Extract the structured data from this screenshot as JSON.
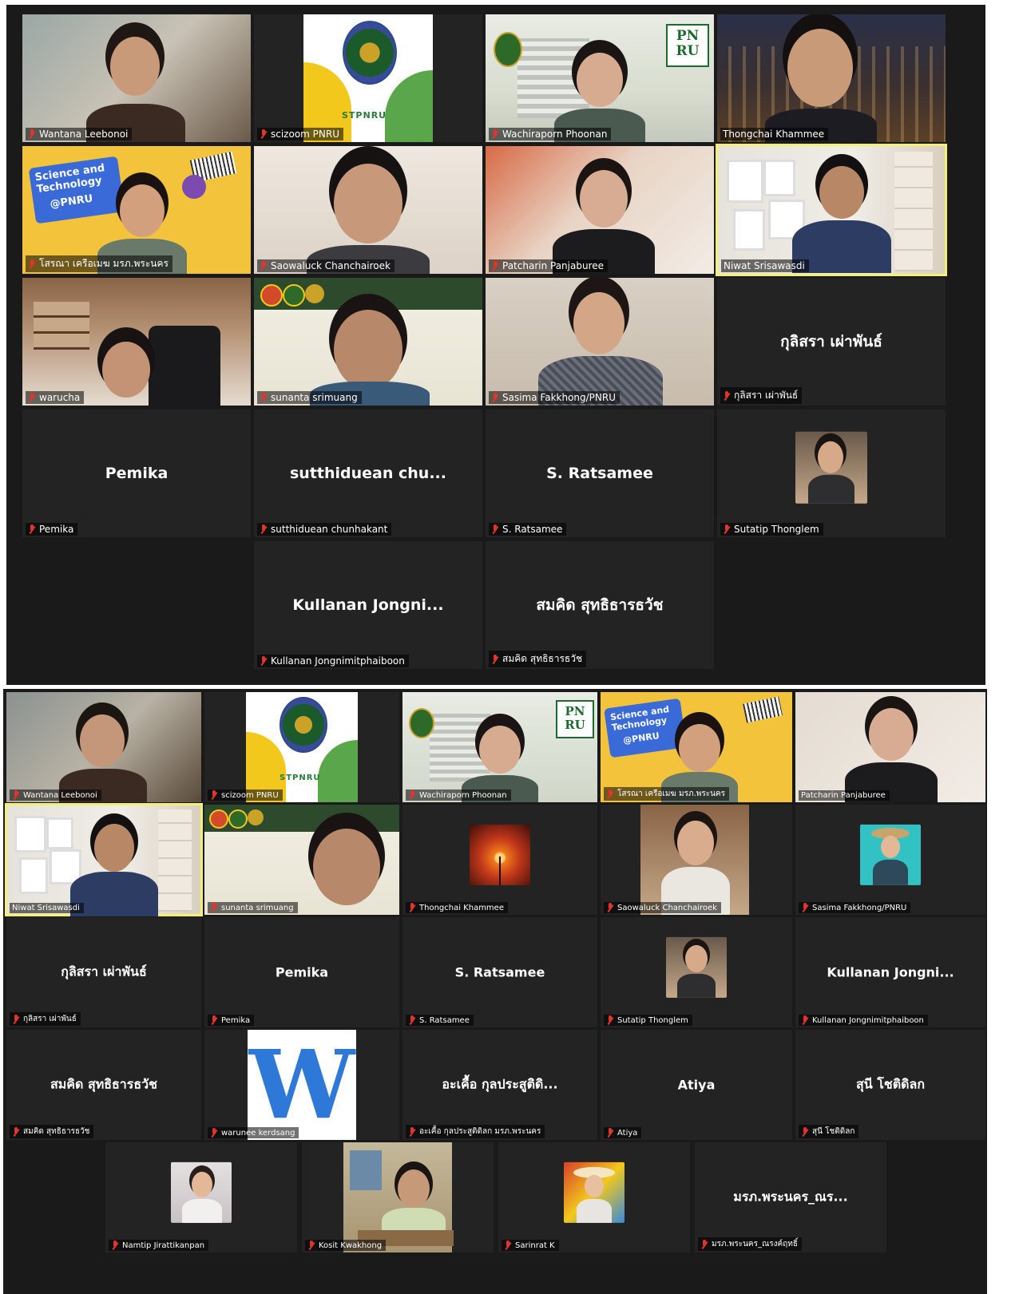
{
  "meeting": {
    "screen1": {
      "tiles": [
        {
          "name": "Wantana Leebonoi"
        },
        {
          "name": "scizoom PNRU",
          "logo": "STPNRU"
        },
        {
          "name": "Wachiraporn Phoonan",
          "logo": "PN RU"
        },
        {
          "name": "Thongchai Khammee"
        },
        {
          "name": "โสรณา เครือเมฆ มรภ.พระนคร",
          "banner": [
            "Science and",
            "Technology",
            "@PNRU"
          ]
        },
        {
          "name": "Saowaluck Chanchairoek"
        },
        {
          "name": "Patcharin Panjaburee"
        },
        {
          "name": "Niwat Srisawasdi"
        },
        {
          "name": "warucha"
        },
        {
          "name": "sunanta srimuang"
        },
        {
          "name": "Sasima Fakkhong/PNRU"
        },
        {
          "name": "กุลิสรา เผ่าพันธ์",
          "display": "กุลิสรา เผ่าพันธ์"
        },
        {
          "name": "Pemika",
          "display": "Pemika"
        },
        {
          "name": "sutthiduean chunhakant",
          "display": "sutthiduean  chu..."
        },
        {
          "name": "S. Ratsamee",
          "display": "S. Ratsamee"
        },
        {
          "name": "Sutatip Thonglem"
        },
        {
          "name": "Kullanan Jongnimitphaiboon",
          "display": "Kullanan  Jongni..."
        },
        {
          "name": "สมคิด สุทธิธารธวัช",
          "display": "สมคิด สุทธิธารธวัช"
        }
      ]
    },
    "screen2": {
      "tiles": [
        {
          "name": "Wantana Leebonoi"
        },
        {
          "name": "scizoom PNRU",
          "logo": "STPNRU"
        },
        {
          "name": "Wachiraporn Phoonan",
          "logo": "PN RU"
        },
        {
          "name": "โสรณา เครือเมฆ มรภ.พระนคร",
          "banner": [
            "Science and",
            "Technology",
            "@PNRU"
          ]
        },
        {
          "name": "Patcharin Panjaburee"
        },
        {
          "name": "Niwat Srisawasdi"
        },
        {
          "name": "sunanta srimuang"
        },
        {
          "name": "Thongchai Khammee"
        },
        {
          "name": "Saowaluck Chanchairoek"
        },
        {
          "name": "Sasima Fakkhong/PNRU"
        },
        {
          "name": "กุลิสรา เผ่าพันธ์",
          "display": "กุลิสรา เผ่าพันธ์"
        },
        {
          "name": "Pemika",
          "display": "Pemika"
        },
        {
          "name": "S. Ratsamee",
          "display": "S. Ratsamee"
        },
        {
          "name": "Sutatip Thonglem"
        },
        {
          "name": "Kullanan Jongnimitphaiboon",
          "display": "Kullanan  Jongni..."
        },
        {
          "name": "สมคิด สุทธิธารธวัช",
          "display": "สมคิด สุทธิธารธวัช"
        },
        {
          "name": "warunee kerdsang",
          "letter": "W"
        },
        {
          "name": "อะเคื้อ กุลประสูติดิลก มรภ.พระนคร",
          "display": "อะเคื้อ กุลประสูติดิ..."
        },
        {
          "name": "Atiya",
          "display": "Atiya"
        },
        {
          "name": "สุนี โชติดิลก",
          "display": "สุนี โชติดิลก"
        },
        {
          "name": "Namtip Jirattikanpan"
        },
        {
          "name": "Kosit Kwakhong"
        },
        {
          "name": "Sarinrat K"
        },
        {
          "name": "มรภ.พระนคร_ณรงค์ฤทธิ์",
          "display": "มรภ.พระนคร_ณร..."
        }
      ]
    }
  },
  "colors": {
    "tile_bg": "#232323",
    "screen_bg": "#1a1a1a",
    "active_border": "#f3f07a",
    "muted_mic": "#e0352b"
  }
}
